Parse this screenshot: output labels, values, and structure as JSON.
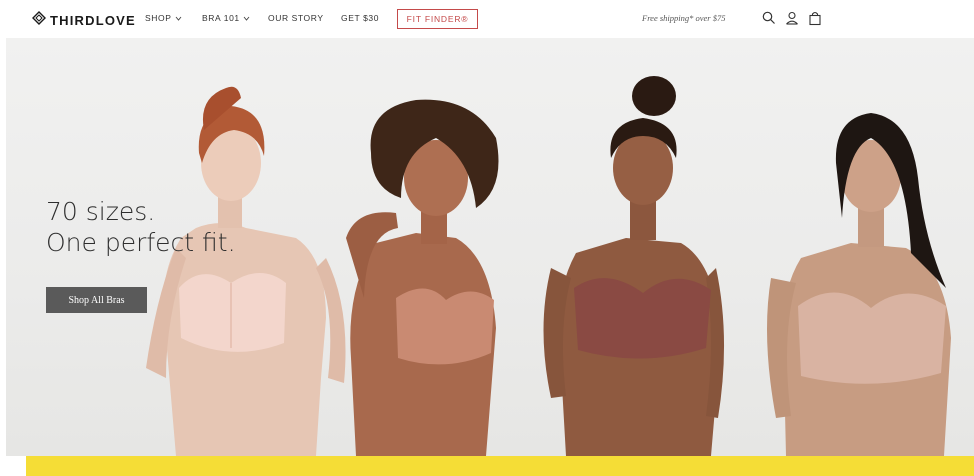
{
  "brand": {
    "name": "THIRDLOVE",
    "logo_icon": "diamond-logo-icon"
  },
  "nav": {
    "items": [
      {
        "label": "SHOP",
        "has_dropdown": true
      },
      {
        "label": "BRA 101",
        "has_dropdown": true
      },
      {
        "label": "OUR STORY",
        "has_dropdown": false
      },
      {
        "label": "GET $30",
        "has_dropdown": false
      }
    ],
    "fit_finder": "FIT FINDER®",
    "shipping_note": "Free shipping* over $75",
    "icons": [
      "search-icon",
      "account-icon",
      "bag-icon"
    ]
  },
  "hero": {
    "headline_line1": "70 sizes.",
    "headline_line2": "One perfect fit.",
    "cta_label": "Shop All Bras",
    "bra_colors": [
      "#f3d6cc",
      "#c98a72",
      "#8a4a43",
      "#d9b3a2"
    ]
  },
  "promo_bar": {
    "color": "#f5dd36"
  }
}
